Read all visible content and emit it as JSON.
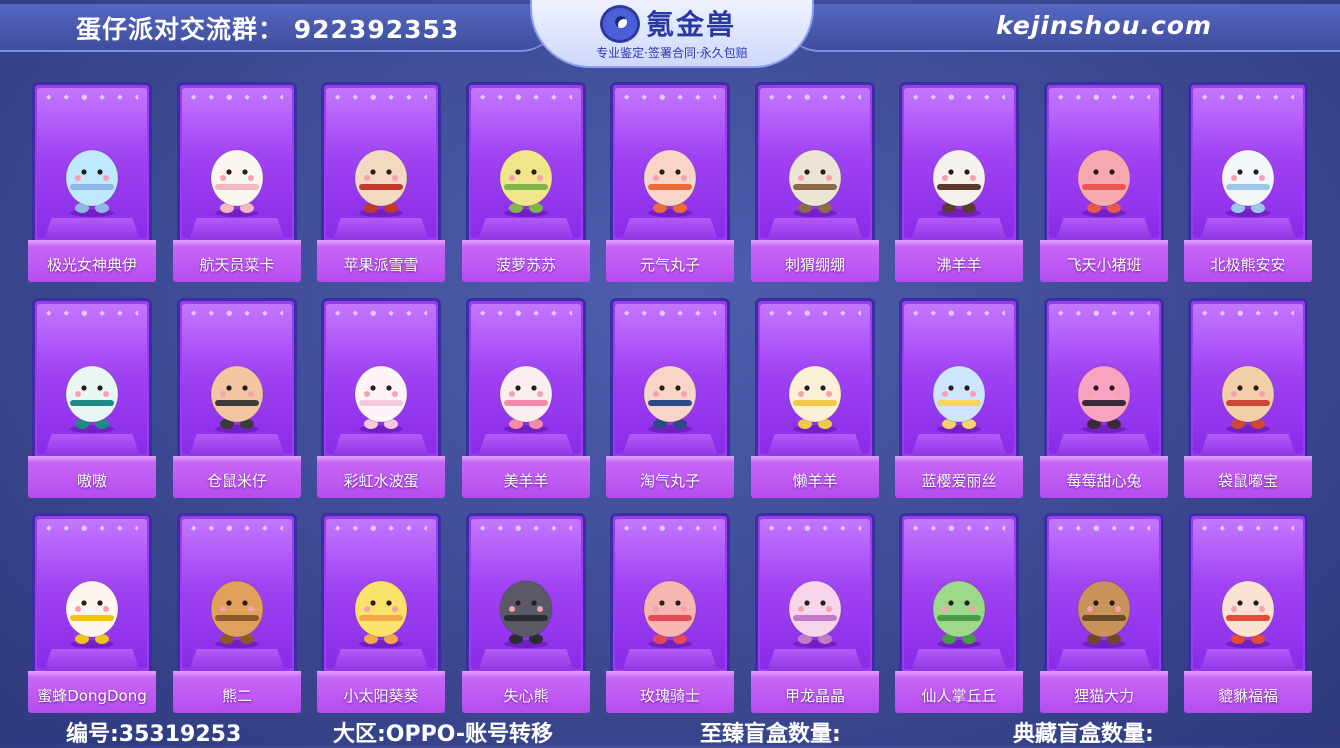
{
  "header": {
    "group_label": "蛋仔派对交流群：",
    "group_number": "922392353",
    "logo_name": "氪金兽",
    "logo_slogan": "专业鉴定·签署合同·永久包赔",
    "site": "kejinshou.com"
  },
  "characters": [
    {
      "name": "极光女神典伊",
      "color": "#bfe9ff",
      "accent": "#8fb7e8"
    },
    {
      "name": "航天员菜卡",
      "color": "#fbf6f0",
      "accent": "#f0b9c0"
    },
    {
      "name": "苹果派雪雪",
      "color": "#f4d9c2",
      "accent": "#c0392b"
    },
    {
      "name": "菠萝苏苏",
      "color": "#f1e58a",
      "accent": "#7fb54a"
    },
    {
      "name": "元气丸子",
      "color": "#f7d6c8",
      "accent": "#e96b3a"
    },
    {
      "name": "刺猬绷绷",
      "color": "#ece4d4",
      "accent": "#8a6a4a"
    },
    {
      "name": "沸羊羊",
      "color": "#f5f2ee",
      "accent": "#5a3a2a"
    },
    {
      "name": "飞天小猪班",
      "color": "#f7a9b0",
      "accent": "#e8574e"
    },
    {
      "name": "北极熊安安",
      "color": "#f3f6fb",
      "accent": "#9cc7ea"
    },
    {
      "name": "嗷嗷",
      "color": "#e8f6f4",
      "accent": "#1f8a86"
    },
    {
      "name": "仓鼠米仔",
      "color": "#f2c6a0",
      "accent": "#3b3b3b"
    },
    {
      "name": "彩虹水波蛋",
      "color": "#fff4f8",
      "accent": "#f7c9dd"
    },
    {
      "name": "美羊羊",
      "color": "#fbeef0",
      "accent": "#f58aa6"
    },
    {
      "name": "淘气丸子",
      "color": "#f7d6c8",
      "accent": "#2a4a8a"
    },
    {
      "name": "懒羊羊",
      "color": "#fbf1d6",
      "accent": "#f2c84b"
    },
    {
      "name": "蓝樱爱丽丝",
      "color": "#cde5ff",
      "accent": "#f5d36a"
    },
    {
      "name": "莓莓甜心兔",
      "color": "#f8a3c0",
      "accent": "#3a2a3a"
    },
    {
      "name": "袋鼠嘟宝",
      "color": "#f1cfa8",
      "accent": "#d0473a"
    },
    {
      "name": "蜜蜂DongDong",
      "color": "#fff6f0",
      "accent": "#f2c21b"
    },
    {
      "name": "熊二",
      "color": "#e0a15a",
      "accent": "#8a5a2a"
    },
    {
      "name": "小太阳葵葵",
      "color": "#fbe26a",
      "accent": "#f6a54a"
    },
    {
      "name": "失心熊",
      "color": "#5a5a66",
      "accent": "#2b2b33"
    },
    {
      "name": "玫瑰骑士",
      "color": "#f7b6b0",
      "accent": "#e24a5a"
    },
    {
      "name": "甲龙晶晶",
      "color": "#f7d6ec",
      "accent": "#c27ac8"
    },
    {
      "name": "仙人掌丘丘",
      "color": "#9ed98a",
      "accent": "#4a9a4a"
    },
    {
      "name": "狸猫大力",
      "color": "#c9935a",
      "accent": "#6a4a2a"
    },
    {
      "name": "貔貅福福",
      "color": "#fbe3d4",
      "accent": "#e24a3a"
    }
  ],
  "footer": {
    "id_text": "编号:35319253",
    "region_text": "大区:OPPO-账号转移",
    "box1_text": "至臻盲盒数量:",
    "box2_text": "典藏盲盒数量:"
  },
  "colors": {
    "background": "#3d4a94",
    "card": "#9a3df0",
    "brand": "#2a38a6"
  }
}
